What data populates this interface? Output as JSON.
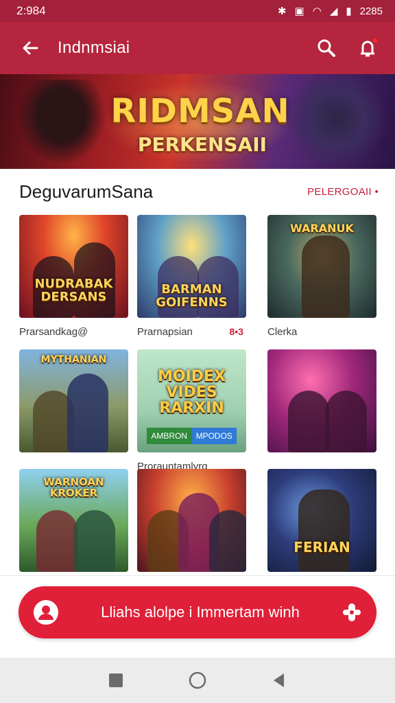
{
  "status_bar": {
    "time_left": "2:984",
    "time_right": "2285"
  },
  "app_bar": {
    "title": "Indnmsiai"
  },
  "banner": {
    "title_line1": "RIDMSAN",
    "title_line2": "PERKENSAII"
  },
  "section": {
    "title": "DeguvarumSana",
    "link": "PELERGOAII •"
  },
  "cards": [
    {
      "logo": "NUDRABAK DERSANS",
      "label": "Prarsandkag@"
    },
    {
      "logo": "BARMAN GOIFENNS",
      "label": "Prarnapsian",
      "badge": "8•3"
    },
    {
      "logo": "WARANUK",
      "label": "Clerka"
    },
    {
      "logo": "MYTHANIAN",
      "label": ""
    },
    {
      "logo": "MOIDEX VIDES RARXIN",
      "label": "Prorauntamlyrg",
      "btn1": "AMBRON",
      "btn2": "MPODOS"
    },
    {
      "logo": "",
      "label": ""
    },
    {
      "logo": "WARNOAN KROKER",
      "label": ""
    },
    {
      "logo": "",
      "label": ""
    },
    {
      "logo": "FERIAN",
      "label": ""
    }
  ],
  "cta": {
    "label": "Lliahs alolpe i Immertam winh"
  },
  "colors": {
    "primary": "#b5253d",
    "accent": "#e01f38"
  }
}
